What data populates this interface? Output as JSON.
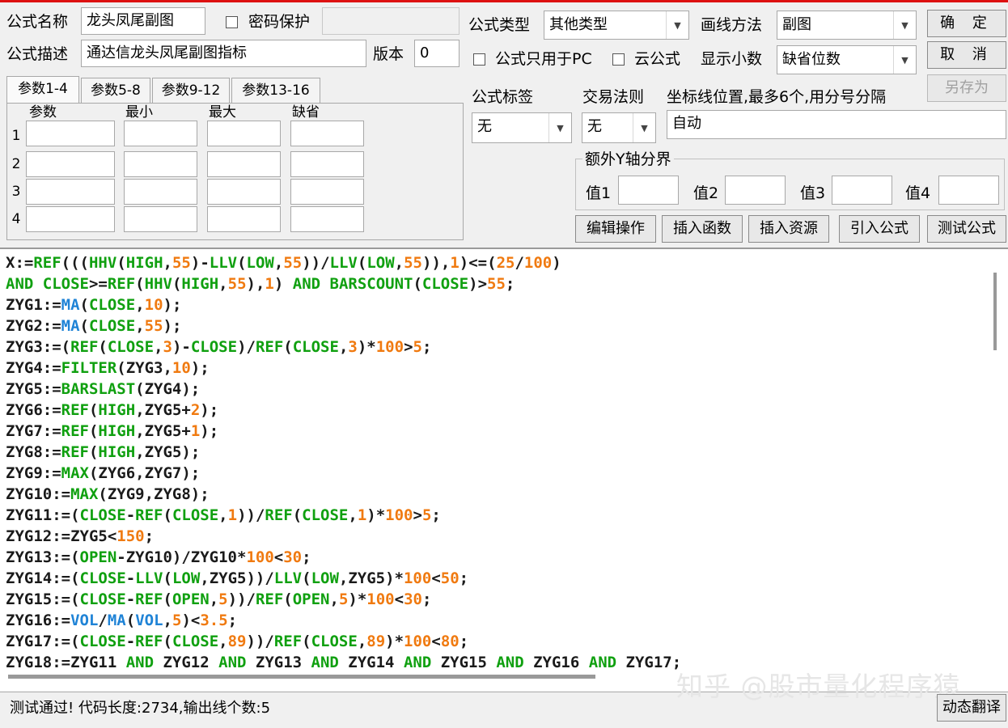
{
  "header": {
    "name_label": "公式名称",
    "name_value": "龙头凤尾副图",
    "password_label": "密码保护",
    "desc_label": "公式描述",
    "desc_value": "通达信龙头凤尾副图指标",
    "version_label": "版本",
    "version_value": "0",
    "type_label": "公式类型",
    "type_value": "其他类型",
    "draw_label": "画线方法",
    "draw_value": "副图",
    "pc_only_label": "公式只用于PC",
    "cloud_label": "云公式",
    "decimal_label": "显示小数",
    "decimal_value": "缺省位数"
  },
  "buttons": {
    "ok": "确 定",
    "cancel": "取 消",
    "save_as": "另存为",
    "edit": "编辑操作",
    "insert_func": "插入函数",
    "insert_res": "插入资源",
    "import": "引入公式",
    "test": "测试公式",
    "translate": "动态翻译"
  },
  "params": {
    "tabs": [
      "参数1-4",
      "参数5-8",
      "参数9-12",
      "参数13-16"
    ],
    "columns": [
      "参数",
      "最小",
      "最大",
      "缺省"
    ],
    "rows": [
      "1",
      "2",
      "3",
      "4"
    ]
  },
  "settings": {
    "tag_label": "公式标签",
    "tag_value": "无",
    "rule_label": "交易法则",
    "rule_value": "无",
    "axis_label": "坐标线位置,最多6个,用分号分隔",
    "axis_value": "自动",
    "yaxis_group": "额外Y轴分界",
    "yvals": [
      "值1",
      "值2",
      "值3",
      "值4"
    ]
  },
  "code_lines": [
    [
      [
        "v",
        "X:="
      ],
      [
        "f",
        "REF"
      ],
      [
        "p",
        "((("
      ],
      [
        "f",
        "HHV"
      ],
      [
        "p",
        "("
      ],
      [
        "f",
        "HIGH"
      ],
      [
        "p",
        ","
      ],
      [
        "n",
        "55"
      ],
      [
        "p",
        ")-"
      ],
      [
        "f",
        "LLV"
      ],
      [
        "p",
        "("
      ],
      [
        "f",
        "LOW"
      ],
      [
        "p",
        ","
      ],
      [
        "n",
        "55"
      ],
      [
        "p",
        "))/"
      ],
      [
        "f",
        "LLV"
      ],
      [
        "p",
        "("
      ],
      [
        "f",
        "LOW"
      ],
      [
        "p",
        ","
      ],
      [
        "n",
        "55"
      ],
      [
        "p",
        "))"
      ],
      [
        "p",
        ","
      ],
      [
        "n",
        "1"
      ],
      [
        "p",
        ")<=("
      ],
      [
        "n",
        "25"
      ],
      [
        "p",
        "/"
      ],
      [
        "n",
        "100"
      ],
      [
        "p",
        ")"
      ]
    ],
    [
      [
        "f",
        "AND CLOSE"
      ],
      [
        "p",
        ">="
      ],
      [
        "f",
        "REF"
      ],
      [
        "p",
        "("
      ],
      [
        "f",
        "HHV"
      ],
      [
        "p",
        "("
      ],
      [
        "f",
        "HIGH"
      ],
      [
        "p",
        ","
      ],
      [
        "n",
        "55"
      ],
      [
        "p",
        "),"
      ],
      [
        "n",
        "1"
      ],
      [
        "p",
        ") "
      ],
      [
        "f",
        "AND BARSCOUNT"
      ],
      [
        "p",
        "("
      ],
      [
        "f",
        "CLOSE"
      ],
      [
        "p",
        ")>"
      ],
      [
        "n",
        "55"
      ],
      [
        "p",
        ";"
      ]
    ],
    [
      [
        "v",
        "ZYG1:="
      ],
      [
        "b",
        "MA"
      ],
      [
        "p",
        "("
      ],
      [
        "f",
        "CLOSE"
      ],
      [
        "p",
        ","
      ],
      [
        "n",
        "10"
      ],
      [
        "p",
        ");"
      ]
    ],
    [
      [
        "v",
        "ZYG2:="
      ],
      [
        "b",
        "MA"
      ],
      [
        "p",
        "("
      ],
      [
        "f",
        "CLOSE"
      ],
      [
        "p",
        ","
      ],
      [
        "n",
        "55"
      ],
      [
        "p",
        ");"
      ]
    ],
    [
      [
        "v",
        "ZYG3:=("
      ],
      [
        "f",
        "REF"
      ],
      [
        "p",
        "("
      ],
      [
        "f",
        "CLOSE"
      ],
      [
        "p",
        ","
      ],
      [
        "n",
        "3"
      ],
      [
        "p",
        ")-"
      ],
      [
        "f",
        "CLOSE"
      ],
      [
        "p",
        ")/"
      ],
      [
        "f",
        "REF"
      ],
      [
        "p",
        "("
      ],
      [
        "f",
        "CLOSE"
      ],
      [
        "p",
        ","
      ],
      [
        "n",
        "3"
      ],
      [
        "p",
        ")*"
      ],
      [
        "n",
        "100"
      ],
      [
        "p",
        ">"
      ],
      [
        "n",
        "5"
      ],
      [
        "p",
        ";"
      ]
    ],
    [
      [
        "v",
        "ZYG4:="
      ],
      [
        "f",
        "FILTER"
      ],
      [
        "p",
        "(ZYG3,"
      ],
      [
        "n",
        "10"
      ],
      [
        "p",
        ");"
      ]
    ],
    [
      [
        "v",
        "ZYG5:="
      ],
      [
        "f",
        "BARSLAST"
      ],
      [
        "p",
        "(ZYG4);"
      ]
    ],
    [
      [
        "v",
        "ZYG6:="
      ],
      [
        "f",
        "REF"
      ],
      [
        "p",
        "("
      ],
      [
        "f",
        "HIGH"
      ],
      [
        "p",
        ",ZYG5+"
      ],
      [
        "n",
        "2"
      ],
      [
        "p",
        ");"
      ]
    ],
    [
      [
        "v",
        "ZYG7:="
      ],
      [
        "f",
        "REF"
      ],
      [
        "p",
        "("
      ],
      [
        "f",
        "HIGH"
      ],
      [
        "p",
        ",ZYG5+"
      ],
      [
        "n",
        "1"
      ],
      [
        "p",
        ");"
      ]
    ],
    [
      [
        "v",
        "ZYG8:="
      ],
      [
        "f",
        "REF"
      ],
      [
        "p",
        "("
      ],
      [
        "f",
        "HIGH"
      ],
      [
        "p",
        ",ZYG5);"
      ]
    ],
    [
      [
        "v",
        "ZYG9:="
      ],
      [
        "f",
        "MAX"
      ],
      [
        "p",
        "(ZYG6,ZYG7);"
      ]
    ],
    [
      [
        "v",
        "ZYG10:="
      ],
      [
        "f",
        "MAX"
      ],
      [
        "p",
        "(ZYG9,ZYG8);"
      ]
    ],
    [
      [
        "v",
        "ZYG11:=("
      ],
      [
        "f",
        "CLOSE"
      ],
      [
        "p",
        "-"
      ],
      [
        "f",
        "REF"
      ],
      [
        "p",
        "("
      ],
      [
        "f",
        "CLOSE"
      ],
      [
        "p",
        ","
      ],
      [
        "n",
        "1"
      ],
      [
        "p",
        "))/"
      ],
      [
        "f",
        "REF"
      ],
      [
        "p",
        "("
      ],
      [
        "f",
        "CLOSE"
      ],
      [
        "p",
        ","
      ],
      [
        "n",
        "1"
      ],
      [
        "p",
        ")*"
      ],
      [
        "n",
        "100"
      ],
      [
        "p",
        ">"
      ],
      [
        "n",
        "5"
      ],
      [
        "p",
        ";"
      ]
    ],
    [
      [
        "v",
        "ZYG12:=ZYG5<"
      ],
      [
        "n",
        "150"
      ],
      [
        "p",
        ";"
      ]
    ],
    [
      [
        "v",
        "ZYG13:=("
      ],
      [
        "f",
        "OPEN"
      ],
      [
        "p",
        "-ZYG10)/ZYG10*"
      ],
      [
        "n",
        "100"
      ],
      [
        "p",
        "<"
      ],
      [
        "n",
        "30"
      ],
      [
        "p",
        ";"
      ]
    ],
    [
      [
        "v",
        "ZYG14:=("
      ],
      [
        "f",
        "CLOSE"
      ],
      [
        "p",
        "-"
      ],
      [
        "f",
        "LLV"
      ],
      [
        "p",
        "("
      ],
      [
        "f",
        "LOW"
      ],
      [
        "p",
        ",ZYG5))/"
      ],
      [
        "f",
        "LLV"
      ],
      [
        "p",
        "("
      ],
      [
        "f",
        "LOW"
      ],
      [
        "p",
        ",ZYG5)*"
      ],
      [
        "n",
        "100"
      ],
      [
        "p",
        "<"
      ],
      [
        "n",
        "50"
      ],
      [
        "p",
        ";"
      ]
    ],
    [
      [
        "v",
        "ZYG15:=("
      ],
      [
        "f",
        "CLOSE"
      ],
      [
        "p",
        "-"
      ],
      [
        "f",
        "REF"
      ],
      [
        "p",
        "("
      ],
      [
        "f",
        "OPEN"
      ],
      [
        "p",
        ","
      ],
      [
        "n",
        "5"
      ],
      [
        "p",
        "))/"
      ],
      [
        "f",
        "REF"
      ],
      [
        "p",
        "("
      ],
      [
        "f",
        "OPEN"
      ],
      [
        "p",
        ","
      ],
      [
        "n",
        "5"
      ],
      [
        "p",
        ")*"
      ],
      [
        "n",
        "100"
      ],
      [
        "p",
        "<"
      ],
      [
        "n",
        "30"
      ],
      [
        "p",
        ";"
      ]
    ],
    [
      [
        "v",
        "ZYG16:="
      ],
      [
        "b",
        "VOL"
      ],
      [
        "p",
        "/"
      ],
      [
        "b",
        "MA"
      ],
      [
        "p",
        "("
      ],
      [
        "b",
        "VOL"
      ],
      [
        "p",
        ","
      ],
      [
        "n",
        "5"
      ],
      [
        "p",
        ")<"
      ],
      [
        "n",
        "3.5"
      ],
      [
        "p",
        ";"
      ]
    ],
    [
      [
        "v",
        "ZYG17:=("
      ],
      [
        "f",
        "CLOSE"
      ],
      [
        "p",
        "-"
      ],
      [
        "f",
        "REF"
      ],
      [
        "p",
        "("
      ],
      [
        "f",
        "CLOSE"
      ],
      [
        "p",
        ","
      ],
      [
        "n",
        "89"
      ],
      [
        "p",
        "))/"
      ],
      [
        "f",
        "REF"
      ],
      [
        "p",
        "("
      ],
      [
        "f",
        "CLOSE"
      ],
      [
        "p",
        ","
      ],
      [
        "n",
        "89"
      ],
      [
        "p",
        ")*"
      ],
      [
        "n",
        "100"
      ],
      [
        "p",
        "<"
      ],
      [
        "n",
        "80"
      ],
      [
        "p",
        ";"
      ]
    ],
    [
      [
        "v",
        "ZYG18:=ZYG11 "
      ],
      [
        "f",
        "AND"
      ],
      [
        "p",
        " ZYG12 "
      ],
      [
        "f",
        "AND"
      ],
      [
        "p",
        " ZYG13 "
      ],
      [
        "f",
        "AND"
      ],
      [
        "p",
        " ZYG14 "
      ],
      [
        "f",
        "AND"
      ],
      [
        "p",
        " ZYG15 "
      ],
      [
        "f",
        "AND"
      ],
      [
        "p",
        " ZYG16 "
      ],
      [
        "f",
        "AND"
      ],
      [
        "p",
        " ZYG17;"
      ]
    ]
  ],
  "status": {
    "text": "测试通过! 代码长度:2734,输出线个数:5",
    "watermark": "知乎 @股市量化程序猿"
  }
}
